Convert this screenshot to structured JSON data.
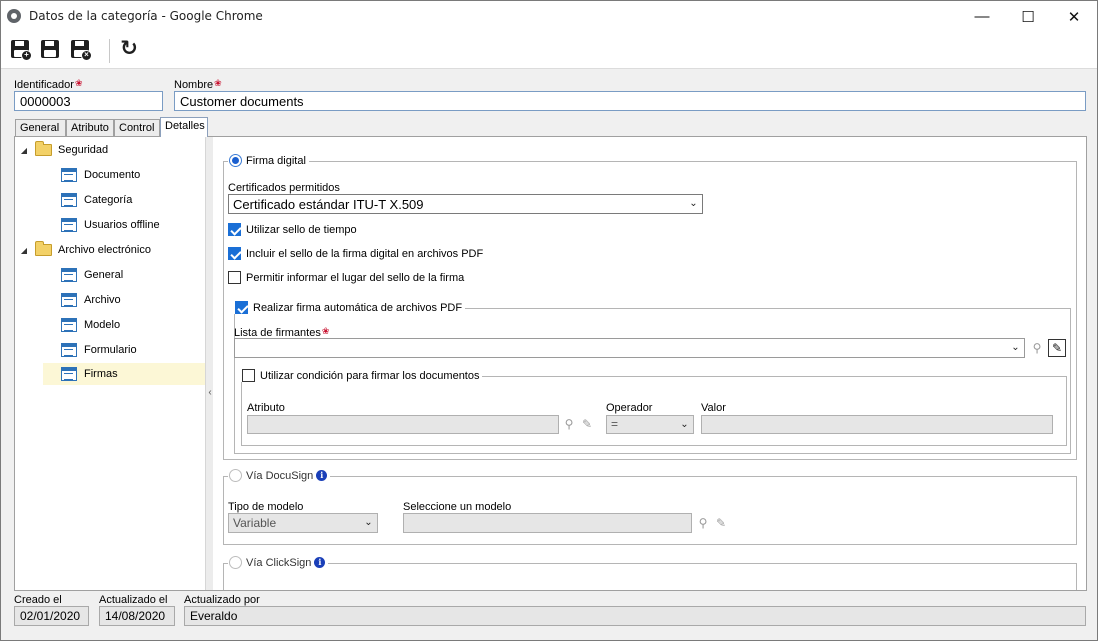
{
  "window": {
    "title": "Datos de la categoría - Google Chrome",
    "minimize": "—",
    "maximize": "☐",
    "close": "✕"
  },
  "toolbar": {
    "badge1": "+",
    "badge2": "·",
    "badge3": "×",
    "refresh": "↻"
  },
  "header": {
    "id_label": "Identificador",
    "id_value": "0000003",
    "name_label": "Nombre",
    "name_value": "Customer documents",
    "required_mark": "❀"
  },
  "tabs": [
    "General",
    "Atributo",
    "Control",
    "Detalles"
  ],
  "tree": {
    "groups": [
      {
        "label": "Seguridad",
        "items": [
          "Documento",
          "Categoría",
          "Usuarios offline"
        ]
      },
      {
        "label": "Archivo electrónico",
        "items": [
          "General",
          "Archivo",
          "Modelo",
          "Formulario",
          "Firmas"
        ]
      }
    ],
    "selected": "Firmas",
    "collapse_arrow": "◢",
    "splitter_arrow": "‹"
  },
  "firma_digital": {
    "label": "Firma digital",
    "certs_label": "Certificados permitidos",
    "certs_value": "Certificado estándar ITU-T X.509",
    "chev": "⌄",
    "opt_timestamp": "Utilizar sello de tiempo",
    "opt_pdf_stamp": "Incluir el sello de la firma digital en archivos PDF",
    "opt_place": "Permitir informar el lugar del sello de la firma",
    "auto_sign": {
      "label": "Realizar firma automática de archivos PDF",
      "signers_label": "Lista de firmantes",
      "signers_value": "",
      "condition": {
        "label": "Utilizar condición para firmar los documentos",
        "attr_label": "Atributo",
        "op_label": "Operador",
        "op_value": "=",
        "val_label": "Valor"
      }
    }
  },
  "docusign": {
    "label": "Vía DocuSign",
    "info": "i",
    "tipo_label": "Tipo de modelo",
    "tipo_value": "Variable",
    "modelo_label": "Seleccione un modelo"
  },
  "clicksign": {
    "label": "Vía ClickSign",
    "info": "i"
  },
  "status": {
    "created_label": "Creado el",
    "created_value": "02/01/2020",
    "updated_label": "Actualizado el",
    "updated_value": "14/08/2020",
    "by_label": "Actualizado por",
    "by_value": "Everaldo"
  },
  "colors": {
    "accent": "#1a6fd6",
    "required": "#c8102e",
    "selected_row": "#fcf7d6"
  }
}
